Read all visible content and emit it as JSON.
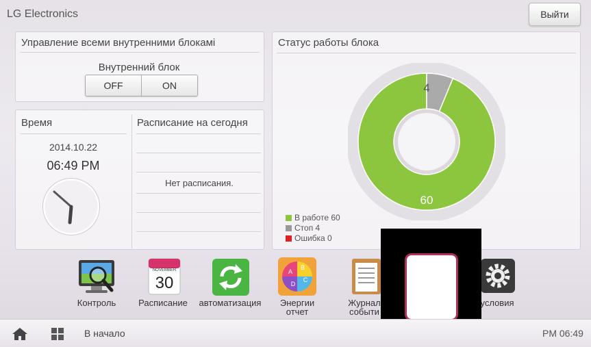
{
  "header": {
    "app_title": "LG Electronics",
    "logout_label": "Выйти"
  },
  "control_panel": {
    "title": "Управление всеми внутренними блокамі",
    "sub_label": "Внутренний блок",
    "off_label": "OFF",
    "on_label": "ON"
  },
  "time_panel": {
    "title": "Время",
    "date": "2014.10.22",
    "clock": "06:49 PM"
  },
  "schedule_panel": {
    "title": "Расписание на сегодня",
    "empty_text": "Нет расписания."
  },
  "status_panel": {
    "title": "Статус работы блока",
    "working_value": "60",
    "stop_value": "4",
    "working_fraction": 0.9375,
    "stop_fraction": 0.0625,
    "colors": {
      "working": "#8cc63f",
      "stop": "#aaaaaa",
      "error": "#dd2222"
    },
    "legend": [
      {
        "label": "В работе 60"
      },
      {
        "label": "Стоп 4"
      },
      {
        "label": "Ошибка 0"
      }
    ]
  },
  "dock": {
    "items": [
      {
        "label": "Контроль",
        "icon": "monitor-magnifier-icon"
      },
      {
        "label": "Расписание",
        "icon": "calendar-icon",
        "calendar_month": "NOVEMBER",
        "calendar_day": "30"
      },
      {
        "label": "автоматизация",
        "icon": "refresh-arrows-icon"
      },
      {
        "label": "Энергии\nотчет",
        "icon": "pie-chart-icon",
        "pie_letters": [
          "A",
          "B",
          "C",
          "D"
        ]
      },
      {
        "label": "Журнал\nсобыти",
        "icon": "clipboard-icon"
      },
      {
        "label": "условия",
        "icon": "gear-icon"
      }
    ]
  },
  "bottom_bar": {
    "home_label": "В начало",
    "time": "PM 06:49"
  }
}
